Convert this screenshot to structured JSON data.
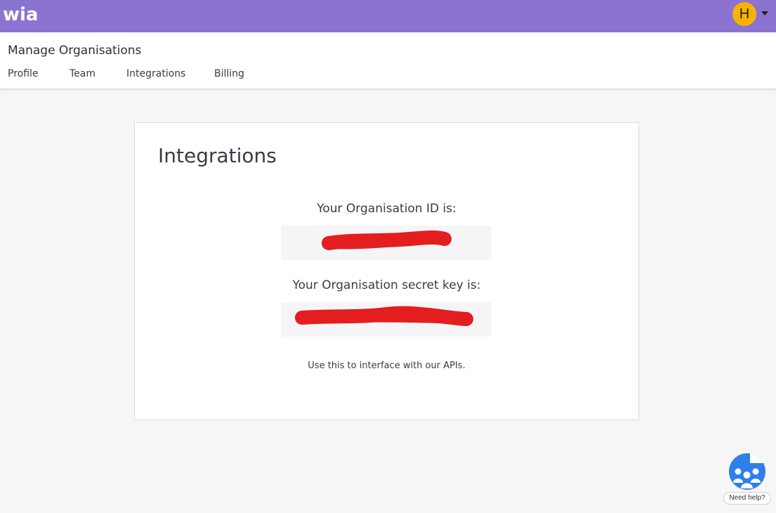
{
  "app": {
    "logo_text": "wia",
    "avatar_initial": "H"
  },
  "header": {
    "title": "Manage Organisations",
    "tabs": [
      {
        "label": "Profile"
      },
      {
        "label": "Team"
      },
      {
        "label": "Integrations"
      },
      {
        "label": "Billing"
      }
    ]
  },
  "card": {
    "title": "Integrations",
    "org_id_label": "Your Organisation ID is:",
    "org_id_value": "",
    "secret_key_label": "Your Organisation secret key is:",
    "secret_key_value": "",
    "hint": "Use this to interface with our APIs."
  },
  "help": {
    "label": "Need help?"
  },
  "colors": {
    "topbar": "#8b74cf",
    "avatar": "#f6b400",
    "redaction": "#e41e1e",
    "help_bubble": "#2f7fe8"
  },
  "icons": {
    "avatar": "user-avatar",
    "caret": "caret-down-icon",
    "help": "help-people-icon"
  }
}
